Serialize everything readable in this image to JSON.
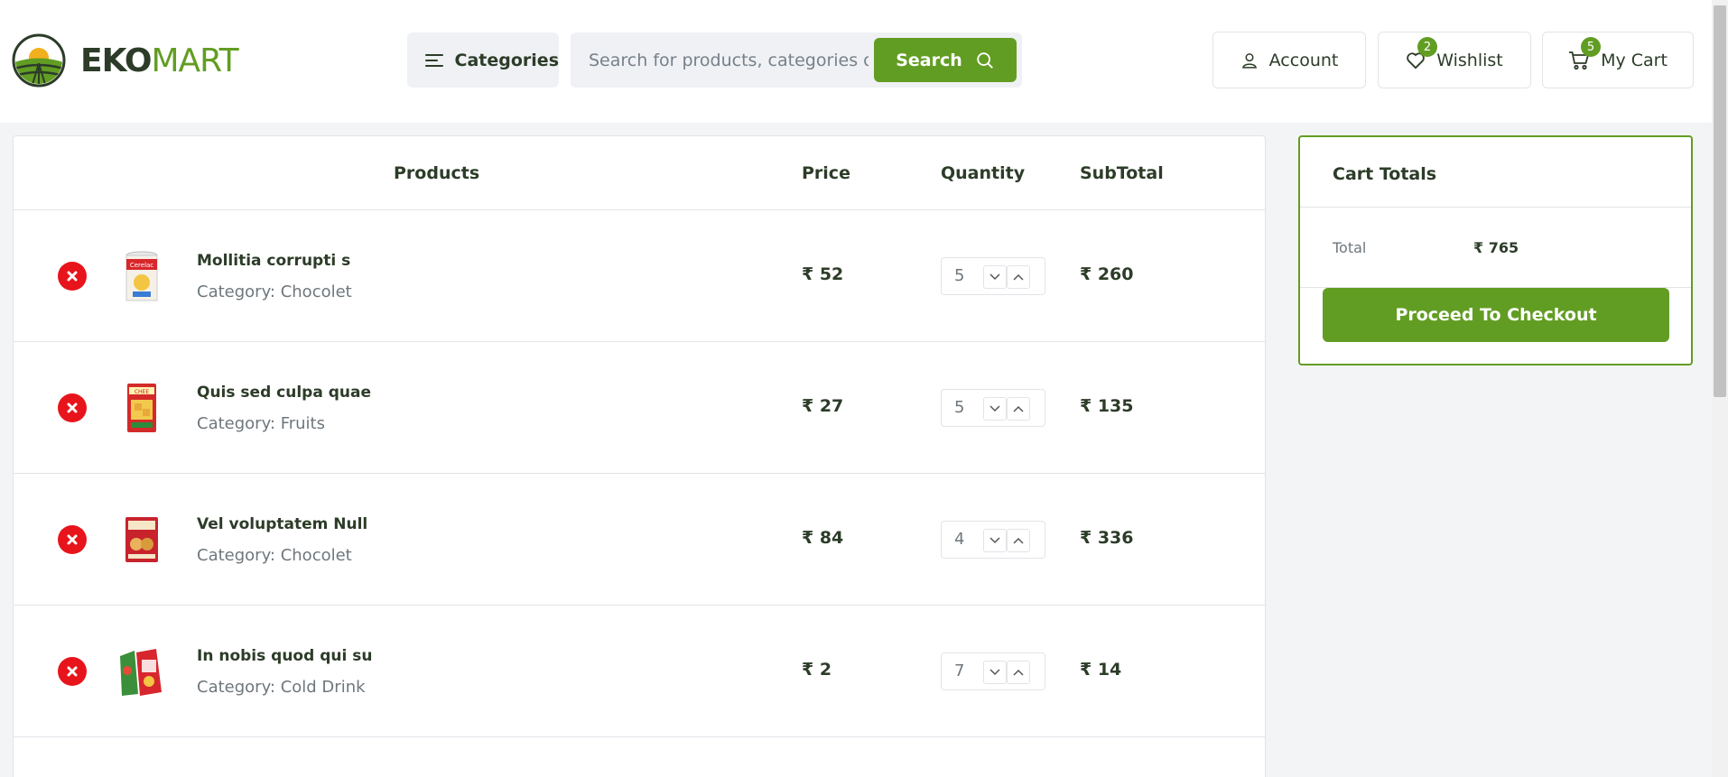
{
  "brand": {
    "name_bold": "EKO",
    "name_light": "MART",
    "accent": "#629d23"
  },
  "header": {
    "categories_label": "Categories",
    "search_placeholder": "Search for products, categories or brands",
    "search_label": "Search",
    "account_label": "Account",
    "wishlist_label": "Wishlist",
    "wishlist_count": "2",
    "cart_label": "My Cart",
    "cart_count": "5"
  },
  "table": {
    "headers": {
      "products": "Products",
      "price": "Price",
      "quantity": "Quantity",
      "subtotal": "SubTotal"
    },
    "rows": [
      {
        "name": "Mollitia corrupti s",
        "category": "Category: Chocolet",
        "price": "₹ 52",
        "qty": "5",
        "subtotal": "₹ 260",
        "thumb_icon": "baby-food-tin-icon"
      },
      {
        "name": "Quis sed culpa quae",
        "category": "Category: Fruits",
        "price": "₹ 27",
        "qty": "5",
        "subtotal": "₹ 135",
        "thumb_icon": "snack-box-icon"
      },
      {
        "name": "Vel voluptatem Null",
        "category": "Category: Chocolet",
        "price": "₹ 84",
        "qty": "4",
        "subtotal": "₹ 336",
        "thumb_icon": "biscuit-pack-icon"
      },
      {
        "name": "In nobis quod qui su",
        "category": "Category: Cold Drink",
        "price": "₹ 2",
        "qty": "7",
        "subtotal": "₹ 14",
        "thumb_icon": "sauce-pack-icon"
      }
    ]
  },
  "totals": {
    "title": "Cart Totals",
    "total_label": "Total",
    "total_value": "₹ 765",
    "checkout_label": "Proceed To Checkout"
  }
}
